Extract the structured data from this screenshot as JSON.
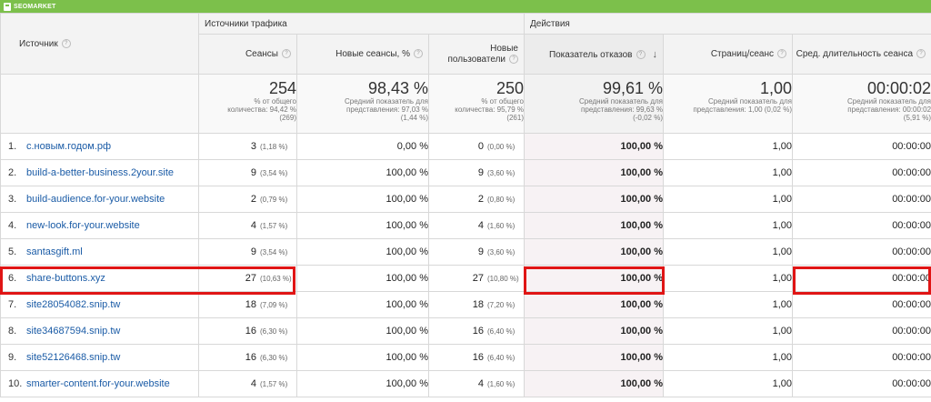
{
  "brand": {
    "logo_text": "SEOMARKET"
  },
  "header": {
    "source_label": "Источник",
    "traffic_group": "Источники трафика",
    "actions_group": "Действия",
    "cols": {
      "sessions": "Сеансы",
      "new_sessions": "Новые сеансы, %",
      "new_users_line1": "Новые",
      "new_users_line2": "пользователи",
      "bounce": "Показатель отказов",
      "pages": "Страниц/сеанс",
      "duration": "Сред. длительность сеанса"
    }
  },
  "summary": {
    "sessions": {
      "value": "254",
      "note1": "% от общего",
      "note2": "количества: 94,42 %",
      "note3": "(269)"
    },
    "new_sessions": {
      "value": "98,43 %",
      "note1": "Средний показатель для",
      "note2": "представления: 97,03 %",
      "note3": "(1,44 %)"
    },
    "new_users": {
      "value": "250",
      "note1": "% от общего",
      "note2": "количества: 95,79 %",
      "note3": "(261)"
    },
    "bounce": {
      "value": "99,61 %",
      "note1": "Средний показатель для",
      "note2": "представления: 99,63 %",
      "note3": "(-0,02 %)"
    },
    "pages": {
      "value": "1,00",
      "note1": "Средний показатель для",
      "note2": "представления: 1,00 (0,02 %)",
      "note3": ""
    },
    "duration": {
      "value": "00:00:02",
      "note1": "Средний показатель для",
      "note2": "представления: 00:00:02",
      "note3": "(5,91 %)"
    }
  },
  "rows": [
    {
      "idx": "1.",
      "source": "с.новым.годом.рф",
      "sessions": "3",
      "sessions_pct": "(1,18 %)",
      "new_sessions": "0,00 %",
      "new_users": "0",
      "new_users_pct": "(0,00 %)",
      "bounce": "100,00 %",
      "pages": "1,00",
      "duration": "00:00:00"
    },
    {
      "idx": "2.",
      "source": "build-a-better-business.2your.site",
      "sessions": "9",
      "sessions_pct": "(3,54 %)",
      "new_sessions": "100,00 %",
      "new_users": "9",
      "new_users_pct": "(3,60 %)",
      "bounce": "100,00 %",
      "pages": "1,00",
      "duration": "00:00:00"
    },
    {
      "idx": "3.",
      "source": "build-audience.for-your.website",
      "sessions": "2",
      "sessions_pct": "(0,79 %)",
      "new_sessions": "100,00 %",
      "new_users": "2",
      "new_users_pct": "(0,80 %)",
      "bounce": "100,00 %",
      "pages": "1,00",
      "duration": "00:00:00"
    },
    {
      "idx": "4.",
      "source": "new-look.for-your.website",
      "sessions": "4",
      "sessions_pct": "(1,57 %)",
      "new_sessions": "100,00 %",
      "new_users": "4",
      "new_users_pct": "(1,60 %)",
      "bounce": "100,00 %",
      "pages": "1,00",
      "duration": "00:00:00"
    },
    {
      "idx": "5.",
      "source": "santasgift.ml",
      "sessions": "9",
      "sessions_pct": "(3,54 %)",
      "new_sessions": "100,00 %",
      "new_users": "9",
      "new_users_pct": "(3,60 %)",
      "bounce": "100,00 %",
      "pages": "1,00",
      "duration": "00:00:00"
    },
    {
      "idx": "6.",
      "source": "share-buttons.xyz",
      "sessions": "27",
      "sessions_pct": "(10,63 %)",
      "new_sessions": "100,00 %",
      "new_users": "27",
      "new_users_pct": "(10,80 %)",
      "bounce": "100,00 %",
      "pages": "1,00",
      "duration": "00:00:00"
    },
    {
      "idx": "7.",
      "source": "site28054082.snip.tw",
      "sessions": "18",
      "sessions_pct": "(7,09 %)",
      "new_sessions": "100,00 %",
      "new_users": "18",
      "new_users_pct": "(7,20 %)",
      "bounce": "100,00 %",
      "pages": "1,00",
      "duration": "00:00:00"
    },
    {
      "idx": "8.",
      "source": "site34687594.snip.tw",
      "sessions": "16",
      "sessions_pct": "(6,30 %)",
      "new_sessions": "100,00 %",
      "new_users": "16",
      "new_users_pct": "(6,40 %)",
      "bounce": "100,00 %",
      "pages": "1,00",
      "duration": "00:00:00"
    },
    {
      "idx": "9.",
      "source": "site52126468.snip.tw",
      "sessions": "16",
      "sessions_pct": "(6,30 %)",
      "new_sessions": "100,00 %",
      "new_users": "16",
      "new_users_pct": "(6,40 %)",
      "bounce": "100,00 %",
      "pages": "1,00",
      "duration": "00:00:00"
    },
    {
      "idx": "10.",
      "source": "smarter-content.for-your.website",
      "sessions": "4",
      "sessions_pct": "(1,57 %)",
      "new_sessions": "100,00 %",
      "new_users": "4",
      "new_users_pct": "(1,60 %)",
      "bounce": "100,00 %",
      "pages": "1,00",
      "duration": "00:00:00"
    }
  ],
  "highlight_color": "#e01515",
  "brand_color": "#7cc04b",
  "link_color": "#1a5ba6"
}
